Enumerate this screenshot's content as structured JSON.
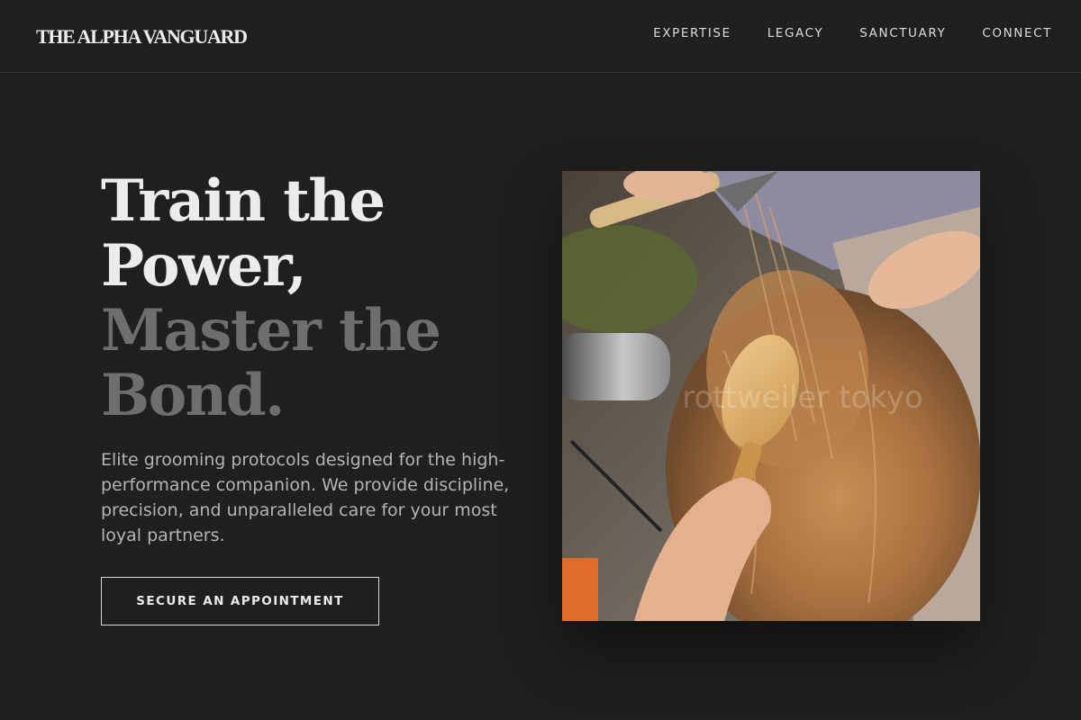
{
  "header": {
    "logo": "THE ALPHA VANGUARD",
    "nav": [
      "EXPERTISE",
      "LEGACY",
      "SANCTUARY",
      "CONNECT"
    ]
  },
  "hero": {
    "title_lines": [
      "Train the",
      "Power,"
    ],
    "title_dim_lines": [
      "Master the",
      "Bond."
    ],
    "description": "Elite grooming protocols designed for the high-performance companion. We provide discipline, precision, and unparalleled care for your most loyal partners.",
    "cta_label": "SECURE AN APPOINTMENT"
  },
  "photo": {
    "subject": "dog being groomed with wooden brush and hair dryer",
    "watermark": "rottweiler tokyo"
  },
  "colors": {
    "background": "#1f1f1f",
    "text": "#ececec",
    "text_dim": "#6e6e6e",
    "body_text": "#b4b4b4"
  }
}
